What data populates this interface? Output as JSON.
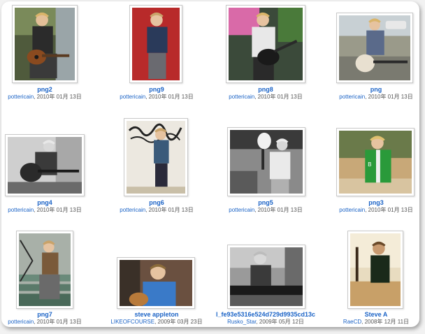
{
  "items": [
    {
      "title": "png2",
      "user": "pottericain",
      "date": "2010年 01月 13日",
      "icon": "photo-guitar-acoustic-dark"
    },
    {
      "title": "png9",
      "user": "pottericain",
      "date": "2010年 01月 13日",
      "icon": "photo-red-wall"
    },
    {
      "title": "png8",
      "user": "pottericain",
      "date": "2010年 01月 13日",
      "icon": "photo-guitar-white-shirt"
    },
    {
      "title": "png",
      "user": "pottericain",
      "date": "2010年 01月 13日",
      "icon": "photo-street-guitar"
    },
    {
      "title": "png4",
      "user": "pottericain",
      "date": "2010年 01月 13日",
      "icon": "photo-bw-guitar"
    },
    {
      "title": "png6",
      "user": "pottericain",
      "date": "2010年 01月 13日",
      "icon": "photo-graffiti-wall"
    },
    {
      "title": "png5",
      "user": "pottericain",
      "date": "2010年 01月 13日",
      "icon": "photo-bw-guitar-overhead"
    },
    {
      "title": "png3",
      "user": "pottericain",
      "date": "2010年 01月 13日",
      "icon": "photo-green-jacket"
    },
    {
      "title": "png7",
      "user": "pottericain",
      "date": "2010年 01月 13日",
      "icon": "photo-stairs"
    },
    {
      "title": "steve appleton",
      "user": "LIKEOFCOURSE",
      "date": "2009年 03月 23日",
      "icon": "photo-blue-shirt-guitar"
    },
    {
      "title": "l_fe93e5316e524d729d9935cd13c",
      "user": "Rusko_Star",
      "date": "2009年 05月 12日",
      "icon": "photo-bw-piano"
    },
    {
      "title": "Steve A",
      "user": "RaeCD",
      "date": "2008年 12月 11日",
      "icon": "photo-sunset-guitar"
    }
  ]
}
